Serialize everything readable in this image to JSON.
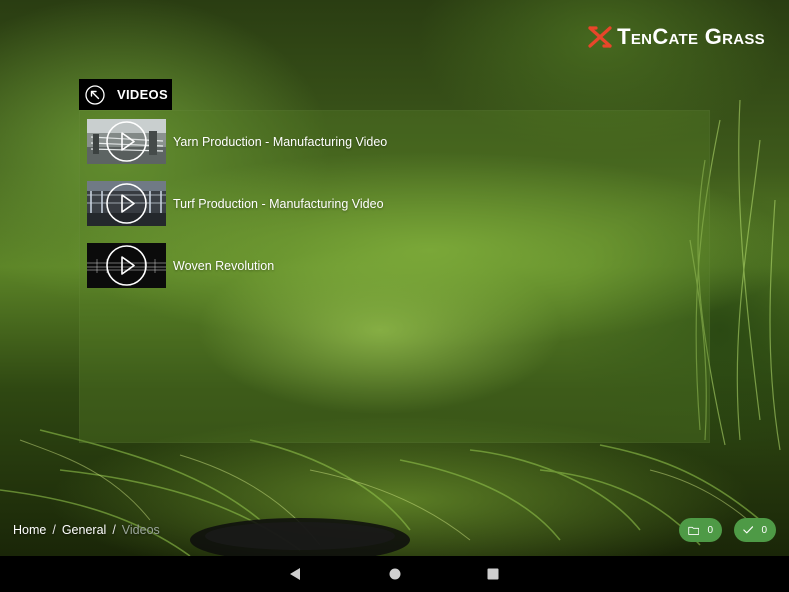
{
  "brand": {
    "logo_text": "TenCate Grass",
    "logo_color": "#e8462a"
  },
  "section": {
    "title": "VIDEOS",
    "back_icon": "arrow-up-left-icon"
  },
  "videos": [
    {
      "title": "Yarn Production - Manufacturing Video",
      "play_icon": "play-icon"
    },
    {
      "title": "Turf Production - Manufacturing Video",
      "play_icon": "play-icon"
    },
    {
      "title": "Woven Revolution",
      "play_icon": "play-icon"
    }
  ],
  "breadcrumb": {
    "items": [
      "Home",
      "General"
    ],
    "current": "Videos",
    "separator": "/"
  },
  "badges": {
    "folder_icon": "folder-icon",
    "folder_count": "0",
    "check_icon": "check-icon",
    "check_count": "0",
    "color": "#4e9a46"
  },
  "navbar": {
    "icons": [
      "back-triangle-icon",
      "home-circle-icon",
      "recents-square-icon"
    ]
  }
}
